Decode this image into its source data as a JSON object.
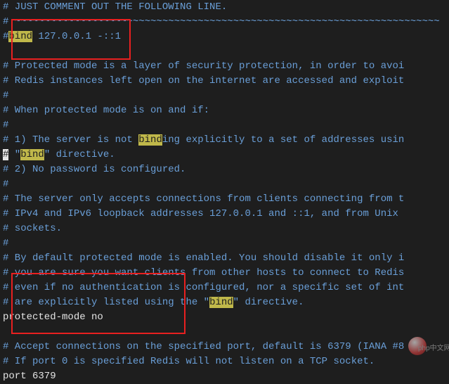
{
  "lines": [
    {
      "seg": [
        {
          "t": "# JUST COMMENT OUT THE FOLLOWING LINE.",
          "cls": "comment"
        }
      ]
    },
    {
      "seg": [
        {
          "t": "# ~~~~~~~~~~~~~~~~~~~~~~~~~~~~~~~~~~~~~~~~~~~~~~~~~~~~~~~~~~~~~~~~~~~~~~~~",
          "cls": "sep"
        }
      ]
    },
    {
      "seg": [
        {
          "t": "#",
          "cls": "comment"
        },
        {
          "t": "bind",
          "cls": "highlight"
        },
        {
          "t": " 127.0.0.1 -::1",
          "cls": "comment"
        }
      ]
    },
    {
      "seg": [
        {
          "t": "",
          "cls": "comment"
        }
      ]
    },
    {
      "seg": [
        {
          "t": "# Protected mode is a layer of security protection, in order to avoi",
          "cls": "comment"
        }
      ]
    },
    {
      "seg": [
        {
          "t": "# Redis instances left open on the internet are accessed and exploit",
          "cls": "comment"
        }
      ]
    },
    {
      "seg": [
        {
          "t": "#",
          "cls": "comment"
        }
      ]
    },
    {
      "seg": [
        {
          "t": "# When protected mode is on and if:",
          "cls": "comment"
        }
      ]
    },
    {
      "seg": [
        {
          "t": "#",
          "cls": "comment"
        }
      ]
    },
    {
      "seg": [
        {
          "t": "# 1) The server is not ",
          "cls": "comment"
        },
        {
          "t": "bind",
          "cls": "highlight"
        },
        {
          "t": "ing explicitly to a set of addresses usin",
          "cls": "comment"
        }
      ]
    },
    {
      "seg": [
        {
          "t": "#",
          "cls": "cursor-mark"
        },
        {
          "t": "    \"",
          "cls": "comment"
        },
        {
          "t": "bind",
          "cls": "highlight"
        },
        {
          "t": "\" directive.",
          "cls": "comment"
        }
      ]
    },
    {
      "seg": [
        {
          "t": "# 2) No password is configured.",
          "cls": "comment"
        }
      ]
    },
    {
      "seg": [
        {
          "t": "#",
          "cls": "comment"
        }
      ]
    },
    {
      "seg": [
        {
          "t": "# The server only accepts connections from clients connecting from t",
          "cls": "comment"
        }
      ]
    },
    {
      "seg": [
        {
          "t": "# IPv4 and IPv6 loopback addresses 127.0.0.1 and ::1, and from Unix ",
          "cls": "comment"
        }
      ]
    },
    {
      "seg": [
        {
          "t": "# sockets.",
          "cls": "comment"
        }
      ]
    },
    {
      "seg": [
        {
          "t": "#",
          "cls": "comment"
        }
      ]
    },
    {
      "seg": [
        {
          "t": "# By default protected mode is enabled. You should disable it only i",
          "cls": "comment"
        }
      ]
    },
    {
      "seg": [
        {
          "t": "# you are sure you want clients from other hosts to connect to Redis",
          "cls": "comment"
        }
      ]
    },
    {
      "seg": [
        {
          "t": "# even if no authentication is configured, nor a specific set of int",
          "cls": "comment"
        }
      ]
    },
    {
      "seg": [
        {
          "t": "# are explicitly listed using the \"",
          "cls": "comment"
        },
        {
          "t": "bind",
          "cls": "highlight"
        },
        {
          "t": "\" directive.",
          "cls": "comment"
        }
      ]
    },
    {
      "seg": [
        {
          "t": "protected-mode no",
          "cls": "normal"
        }
      ]
    },
    {
      "seg": [
        {
          "t": "",
          "cls": "normal"
        }
      ]
    },
    {
      "seg": [
        {
          "t": "# Accept connections on the specified port, default is 6379 (IANA #8",
          "cls": "comment"
        }
      ]
    },
    {
      "seg": [
        {
          "t": "# If port 0 is specified Redis will not listen on a TCP s",
          "cls": "comment"
        },
        {
          "t": "ocket.",
          "cls": "comment"
        }
      ]
    },
    {
      "seg": [
        {
          "t": "port 6379",
          "cls": "normal"
        }
      ]
    }
  ],
  "watermark": "php中文网"
}
